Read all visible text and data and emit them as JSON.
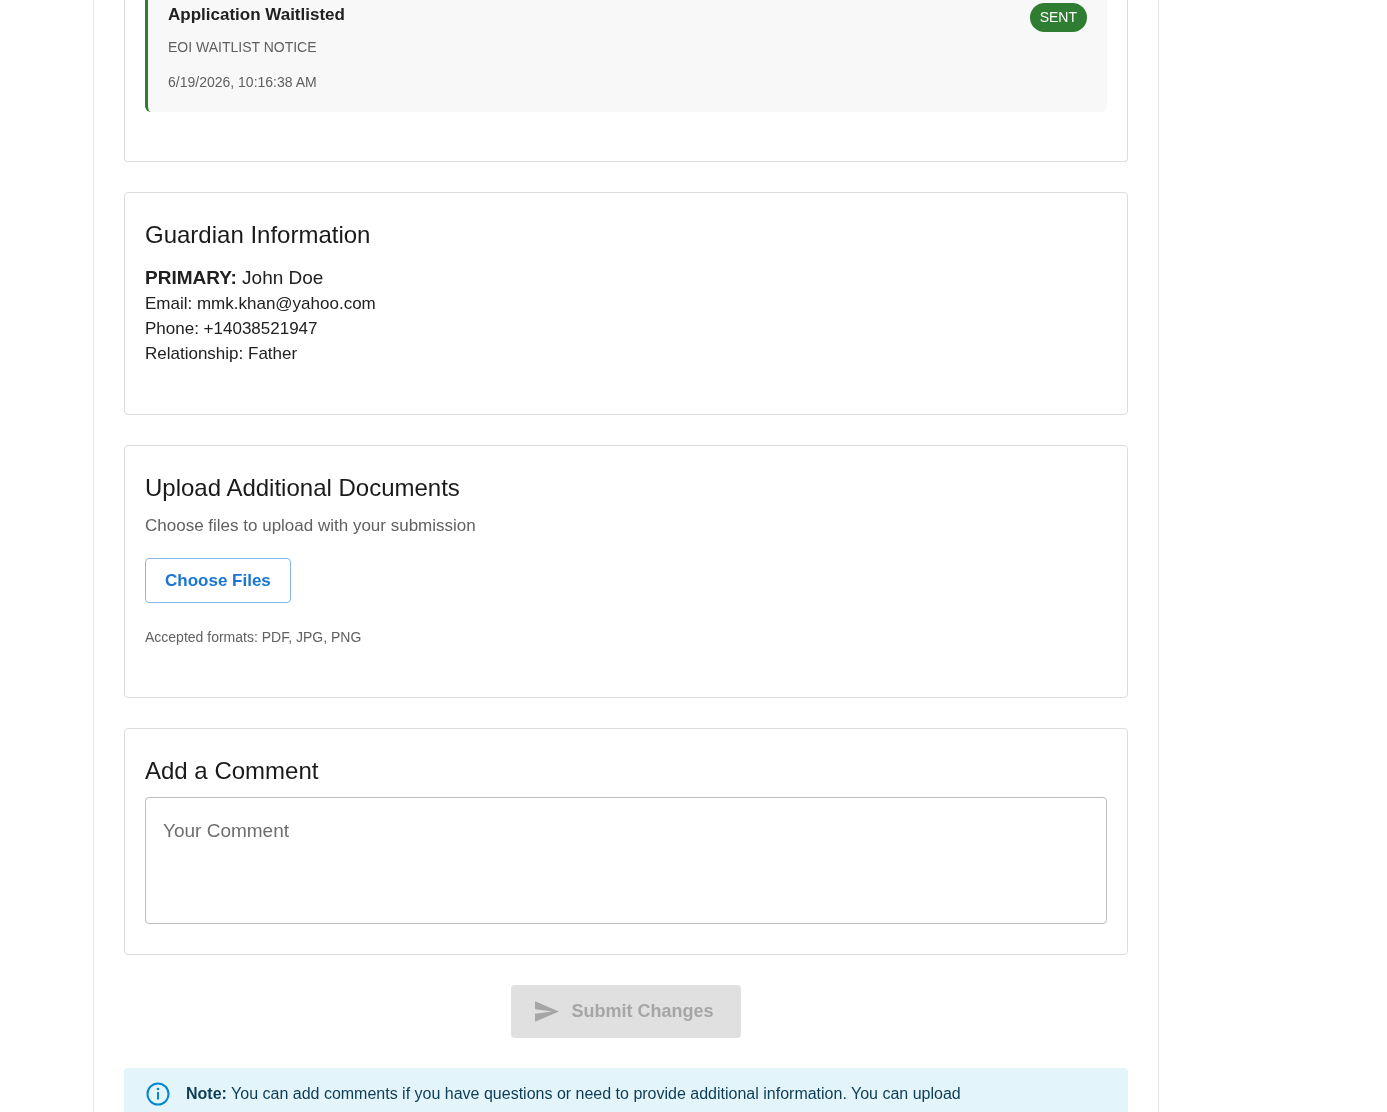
{
  "notification": {
    "title": "Application Waitlisted",
    "type_label": "EOI WAITLIST NOTICE",
    "timestamp": "6/19/2026, 10:16:38 AM",
    "status": "SENT"
  },
  "guardian": {
    "heading": "Guardian Information",
    "primary": "**PRIMARY:** John Doe",
    "lines": [
      "Email: mmk.khan@yahoo.com",
      "Phone: +14038521947",
      "Relationship: Father"
    ]
  },
  "upload": {
    "heading": "Upload Additional Documents",
    "description": "Choose files to upload with your submission",
    "button": "Choose Files",
    "formats_hint": "Accepted formats: PDF, JPG, PNG"
  },
  "comment": {
    "heading": "Add a Comment",
    "placeholder": "Your Comment"
  },
  "submit_button": {
    "label": "Submit Changes",
    "disabled": true
  },
  "note": {
    "text": "**Note:** You can add comments if you have questions or need to provide additional information. You can upload"
  }
}
